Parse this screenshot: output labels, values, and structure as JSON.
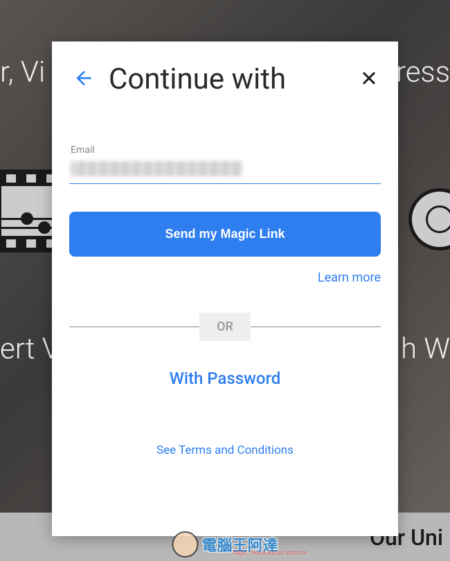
{
  "background": {
    "text_top_left": "r, Vi",
    "text_top_right": "ress",
    "text_mid_left": "ert V",
    "text_mid_right": "h W",
    "bottom_right": "Our Uni"
  },
  "modal": {
    "title": "Continue with",
    "email_label": "Email",
    "send_button": "Send my Magic Link",
    "learn_more": "Learn more",
    "divider": "OR",
    "password_option": "With Password",
    "terms_link": "See Terms and Conditions"
  },
  "watermark": {
    "text": "電腦王阿達",
    "url": "https://www.kocpc.com.tw"
  }
}
